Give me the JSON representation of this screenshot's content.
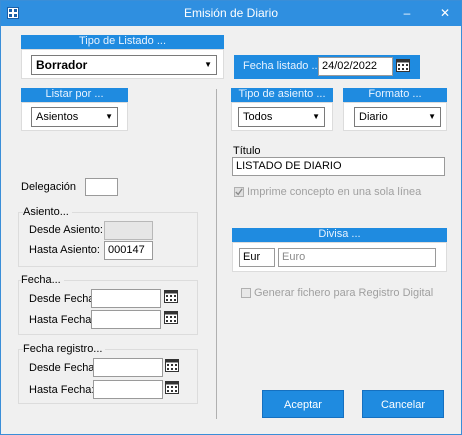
{
  "window": {
    "title": "Emisión de Diario",
    "minimize": "–",
    "close": "✕"
  },
  "tipo_listado": {
    "header": "Tipo de Listado ...",
    "value": "Borrador"
  },
  "fecha_listado": {
    "label": "Fecha listado ...",
    "value": "24/02/2022"
  },
  "listar_por": {
    "header": "Listar por ...",
    "value": "Asientos"
  },
  "tipo_asiento": {
    "header": "Tipo de asiento ...",
    "value": "Todos"
  },
  "formato": {
    "header": "Formato ...",
    "value": "Diario"
  },
  "titulo": {
    "label": "Título",
    "value": "LISTADO DE DIARIO"
  },
  "imprime_concepto": {
    "label": "Imprime concepto en una sola línea",
    "checked": true
  },
  "delegacion": {
    "label": "Delegación",
    "value": ""
  },
  "asiento": {
    "title": "Asiento...",
    "desde_label": "Desde Asiento:",
    "desde_value": "",
    "hasta_label": "Hasta Asiento:",
    "hasta_value": "000147"
  },
  "divisa": {
    "header": "Divisa ...",
    "code": "Eur",
    "name": "Euro"
  },
  "fecha": {
    "title": "Fecha...",
    "desde_label": "Desde Fecha:",
    "desde_value": "",
    "hasta_label": "Hasta Fecha:",
    "hasta_value": ""
  },
  "generar_fichero": {
    "label": "Generar fichero para Registro Digital",
    "checked": false
  },
  "fecha_registro": {
    "title": "Fecha registro...",
    "desde_label": "Desde Fecha:",
    "desde_value": "",
    "hasta_label": "Hasta Fecha:",
    "hasta_value": ""
  },
  "buttons": {
    "aceptar": "Aceptar",
    "cancelar": "Cancelar"
  }
}
